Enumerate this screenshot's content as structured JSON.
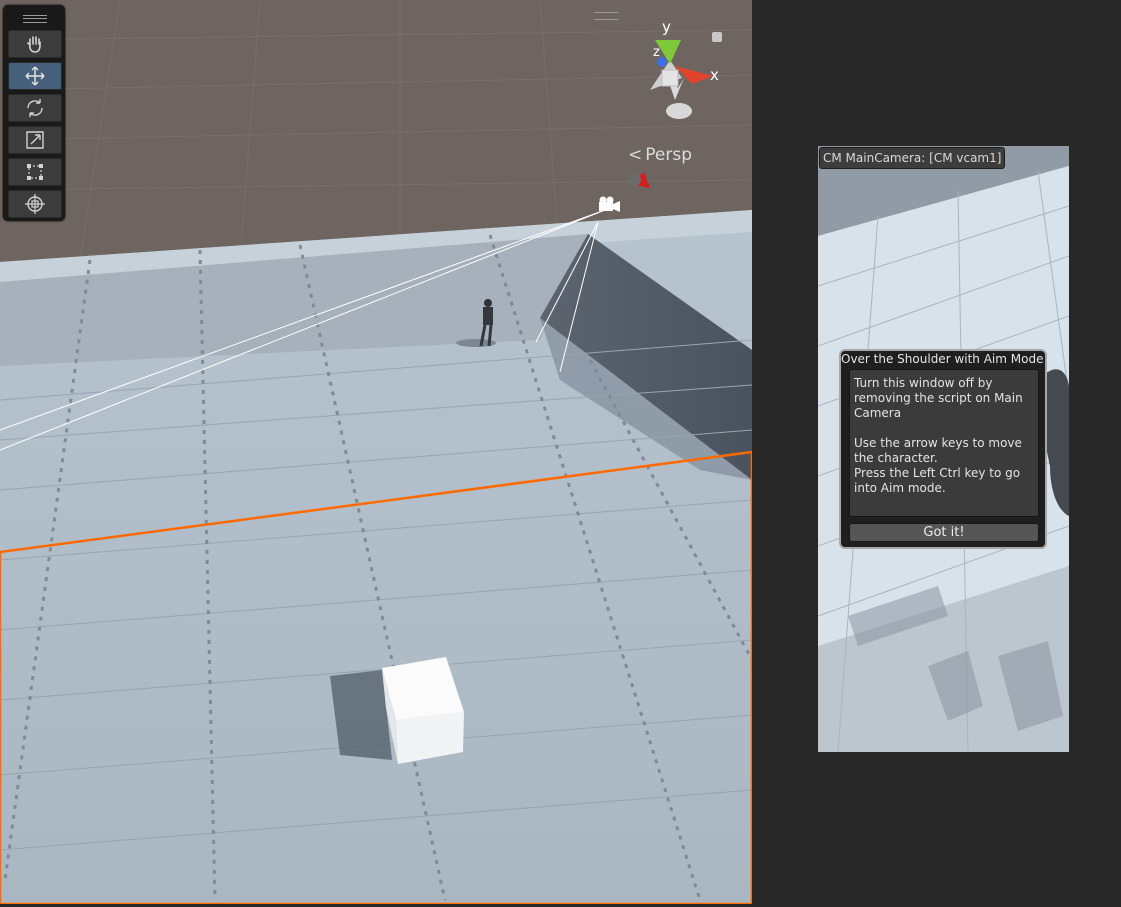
{
  "scene_view": {
    "tools": [
      {
        "name": "hand-tool-icon",
        "active": false
      },
      {
        "name": "move-tool-icon",
        "active": true
      },
      {
        "name": "rotate-tool-icon",
        "active": false
      },
      {
        "name": "scale-tool-icon",
        "active": false
      },
      {
        "name": "rect-tool-icon",
        "active": false
      },
      {
        "name": "transform-tool-icon",
        "active": false
      }
    ],
    "gizmo": {
      "y_label": "y",
      "z_label": "z",
      "x_label": "x"
    },
    "projection_label": "Persp",
    "selection_color": "#ff6a00"
  },
  "game_view": {
    "camera_label": "CM MainCamera: [CM vcam1]",
    "help_window": {
      "title": "Over the Shoulder with Aim Mode",
      "body": "Turn this window off by\nremoving the script on Main\nCamera\n\nUse the arrow keys to move\nthe character.\nPress the Left Ctrl key to go\ninto Aim mode.",
      "button_label": "Got it!"
    }
  },
  "colors": {
    "editor_background": "#282828",
    "active_tool": "#46607c",
    "gizmo_x": "#e0442d",
    "gizmo_y": "#7ec83a",
    "gizmo_z": "#3c6fe0"
  }
}
